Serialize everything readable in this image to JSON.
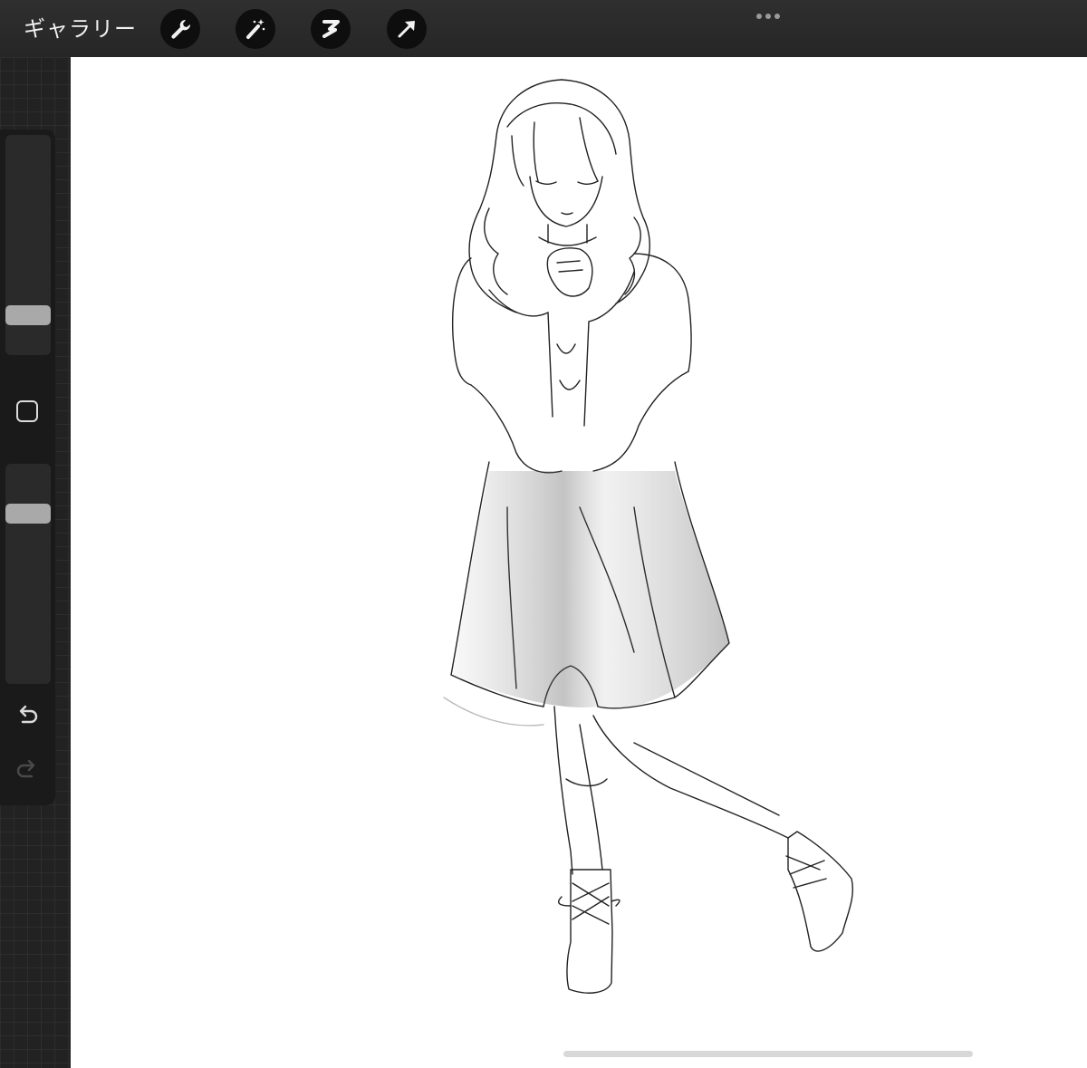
{
  "topbar": {
    "gallery_label": "ギャラリー",
    "tools": [
      {
        "name": "wrench-icon"
      },
      {
        "name": "magic-wand-icon"
      },
      {
        "name": "selection-s-icon"
      },
      {
        "name": "transform-arrow-icon"
      }
    ],
    "more_icon": "ellipsis-icon"
  },
  "sidebar": {
    "brush_size": 0.15,
    "opacity": 0.8,
    "modify_icon": "square-icon",
    "undo_icon": "undo-icon",
    "redo_icon": "redo-icon",
    "redo_enabled": false
  },
  "colors": {
    "toolbar_bg": "#2b2b2b",
    "sidebar_bg": "#1a1a1a",
    "thumb": "#a9a9a9",
    "canvas": "#ffffff"
  }
}
